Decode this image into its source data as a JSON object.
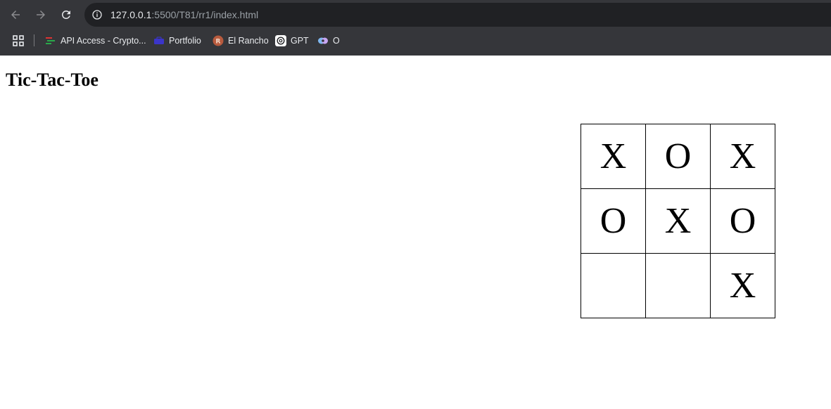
{
  "browser": {
    "url_host": "127.0.0.1",
    "url_rest": ":5500/T81/rr1/index.html",
    "bookmarks": [
      {
        "label": "API Access - Crypto...",
        "icon": "chart-bars-icon",
        "color": "#2aa84a"
      },
      {
        "label": "Portfolio",
        "icon": "briefcase-icon",
        "color": "#3b35c9"
      },
      {
        "label": "El Rancho",
        "icon": "r-circle-icon",
        "color": "#b85b3e"
      },
      {
        "label": "GPT",
        "icon": "openai-icon",
        "color": "#ffffff"
      },
      {
        "label": "O",
        "icon": "copilot-icon",
        "color": "#7fb8f0"
      }
    ]
  },
  "page": {
    "title": "Tic-Tac-Toe"
  },
  "board": {
    "cells": [
      "X",
      "O",
      "X",
      "O",
      "X",
      "O",
      "",
      "",
      "X"
    ]
  }
}
